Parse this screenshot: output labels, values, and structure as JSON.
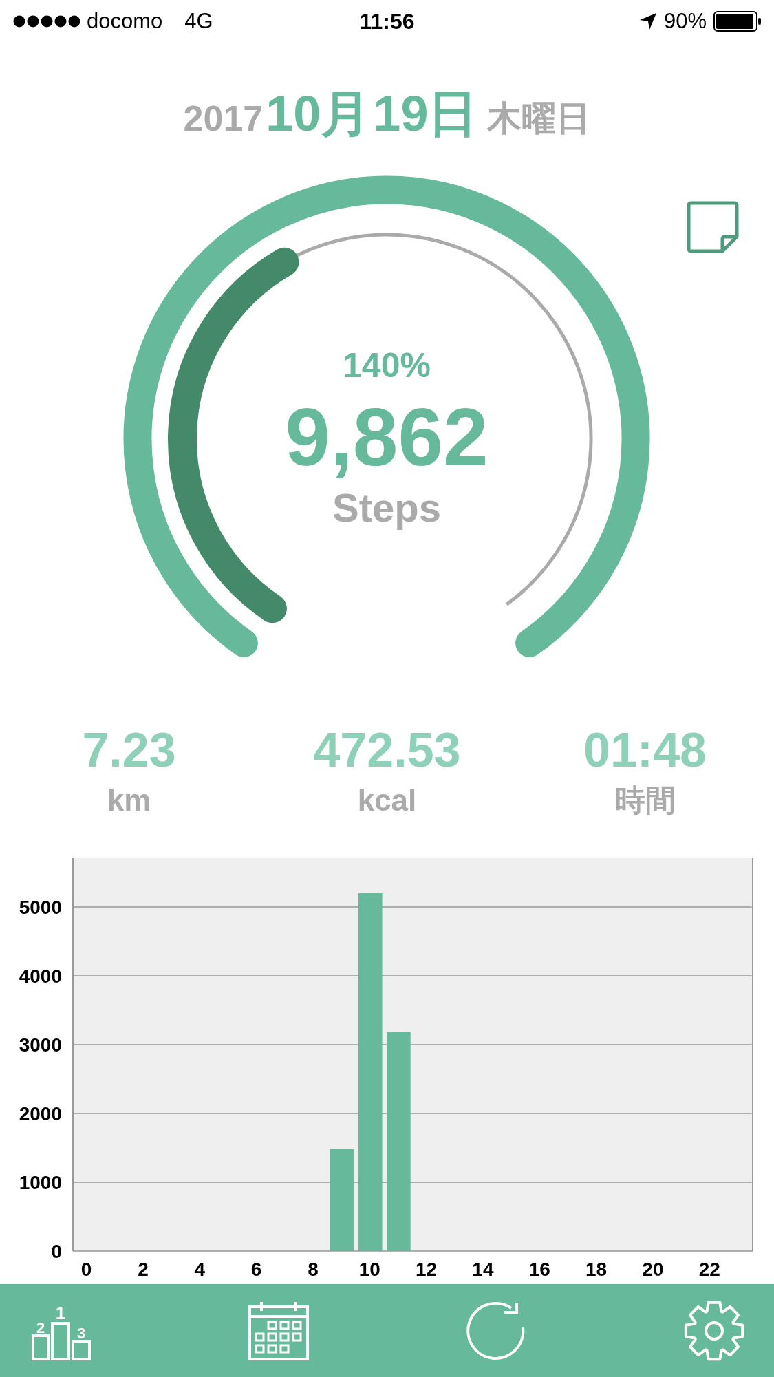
{
  "status_bar": {
    "carrier": "docomo",
    "network": "4G",
    "time": "11:56",
    "battery": "90%"
  },
  "date": {
    "year": "2017",
    "month": "10月",
    "day": "19日",
    "weekday": "木曜日"
  },
  "gauge": {
    "percent": "140%",
    "steps": "9,862",
    "unit": "Steps"
  },
  "stats": [
    {
      "value": "7.23",
      "unit": "km"
    },
    {
      "value": "472.53",
      "unit": "kcal"
    },
    {
      "value": "01:48",
      "unit": "時間"
    }
  ],
  "chart": {
    "chart_data": {
      "type": "bar",
      "x": [
        0,
        1,
        2,
        3,
        4,
        5,
        6,
        7,
        8,
        9,
        10,
        11,
        12,
        13,
        14,
        15,
        16,
        17,
        18,
        19,
        20,
        21,
        22,
        23
      ],
      "series": [
        {
          "color": "#67b99b",
          "values": [
            0,
            0,
            0,
            0,
            0,
            0,
            0,
            0,
            0,
            1480,
            5200,
            3180,
            0,
            0,
            0,
            0,
            0,
            0,
            0,
            0,
            0,
            0,
            0,
            0
          ]
        }
      ],
      "xticks": [
        0,
        2,
        4,
        6,
        8,
        10,
        12,
        14,
        16,
        18,
        20,
        22
      ],
      "yticks": [
        0,
        1000,
        2000,
        3000,
        4000,
        5000
      ],
      "xlim": [
        -0.5,
        23.5
      ],
      "ylim": [
        0,
        5710
      ],
      "grid": true
    }
  },
  "tab_bar": [
    {
      "kind": "ranking",
      "labels": [
        "2",
        "1",
        "3"
      ]
    },
    {
      "kind": "calendar"
    },
    {
      "kind": "refresh"
    },
    {
      "kind": "settings"
    }
  ]
}
